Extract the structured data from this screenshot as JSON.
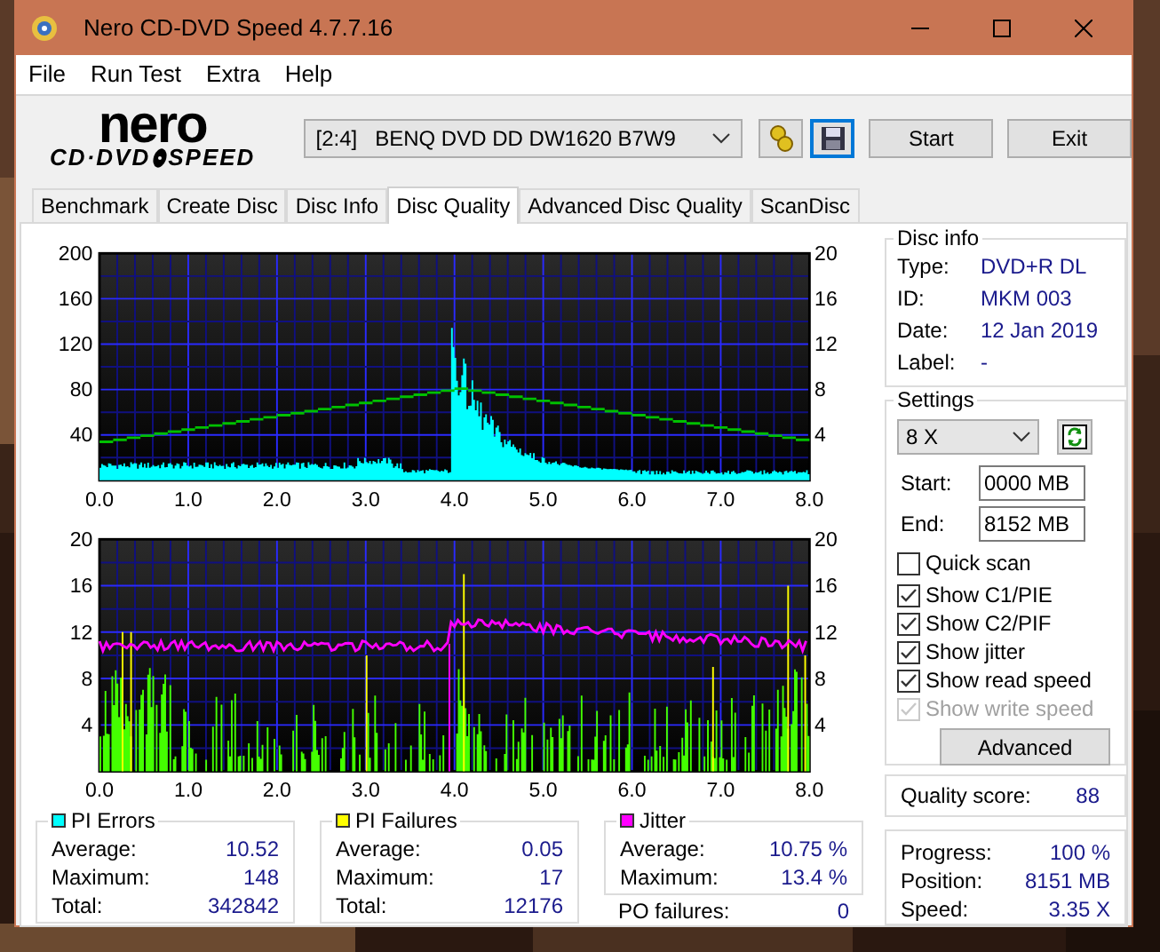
{
  "window": {
    "title": "Nero CD-DVD Speed 4.7.7.16"
  },
  "menu": [
    "File",
    "Run Test",
    "Extra",
    "Help"
  ],
  "logo": {
    "brand": "nero",
    "product_left": "CD·DVD",
    "product_right": "SPEED"
  },
  "toolbar": {
    "drive_slot": "[2:4]",
    "drive_name": "BENQ DVD DD DW1620 B7W9",
    "buttons": [
      "Start",
      "Exit"
    ]
  },
  "tabs": [
    {
      "label": "Benchmark",
      "selected": false
    },
    {
      "label": "Create Disc",
      "selected": false
    },
    {
      "label": "Disc Info",
      "selected": false
    },
    {
      "label": "Disc Quality",
      "selected": true
    },
    {
      "label": "Advanced Disc Quality",
      "selected": false
    },
    {
      "label": "ScanDisc",
      "selected": false
    }
  ],
  "charts": [
    {
      "kind": "errors",
      "left_ticks": [
        "200",
        "160",
        "120",
        "80",
        "40"
      ],
      "right_ticks": [
        "20",
        "16",
        "12",
        "8",
        "4"
      ],
      "x_ticks": [
        "0.0",
        "1.0",
        "2.0",
        "3.0",
        "4.0",
        "5.0",
        "6.0",
        "7.0",
        "8.0"
      ]
    },
    {
      "kind": "failures",
      "left_ticks": [
        "20",
        "16",
        "12",
        "8",
        "4"
      ],
      "right_ticks": [
        "20",
        "16",
        "12",
        "8",
        "4"
      ],
      "x_ticks": [
        "0.0",
        "1.0",
        "2.0",
        "3.0",
        "4.0",
        "5.0",
        "6.0",
        "7.0",
        "8.0"
      ]
    }
  ],
  "disc_info": {
    "title": "Disc info",
    "fields": [
      {
        "label": "Type:",
        "value": "DVD+R DL"
      },
      {
        "label": "ID:",
        "value": "MKM 003"
      },
      {
        "label": "Date:",
        "value": "12 Jan 2019"
      },
      {
        "label": "Label:",
        "value": "-"
      }
    ]
  },
  "settings": {
    "title": "Settings",
    "speed": "8 X",
    "start_label": "Start:",
    "start": "0000 MB",
    "end_label": "End:",
    "end": "8152 MB",
    "options": [
      {
        "label": "Quick scan",
        "checked": false,
        "disabled": false
      },
      {
        "label": "Show C1/PIE",
        "checked": true,
        "disabled": false
      },
      {
        "label": "Show C2/PIF",
        "checked": true,
        "disabled": false
      },
      {
        "label": "Show jitter",
        "checked": true,
        "disabled": false
      },
      {
        "label": "Show read speed",
        "checked": true,
        "disabled": false
      },
      {
        "label": "Show write speed",
        "checked": true,
        "disabled": true
      }
    ],
    "advanced": "Advanced"
  },
  "quality": {
    "label": "Quality score:",
    "value": "88"
  },
  "stats": [
    {
      "title": "PI Errors",
      "color": "#00ffff",
      "rows": [
        {
          "label": "Average:",
          "value": "10.52"
        },
        {
          "label": "Maximum:",
          "value": "148"
        },
        {
          "label": "Total:",
          "value": "342842"
        }
      ]
    },
    {
      "title": "PI Failures",
      "color": "#ffff00",
      "rows": [
        {
          "label": "Average:",
          "value": "0.05"
        },
        {
          "label": "Maximum:",
          "value": "17"
        },
        {
          "label": "Total:",
          "value": "12176"
        }
      ]
    },
    {
      "title": "Jitter",
      "color": "#ff00ff",
      "rows": [
        {
          "label": "Average:",
          "value": "10.75 %"
        },
        {
          "label": "Maximum:",
          "value": "13.4 %"
        }
      ]
    }
  ],
  "po_failures": {
    "label": "PO failures:",
    "value": "0"
  },
  "progress": [
    {
      "label": "Progress:",
      "value": "100 %"
    },
    {
      "label": "Position:",
      "value": "8151 MB"
    },
    {
      "label": "Speed:",
      "value": "3.35 X"
    }
  ]
}
